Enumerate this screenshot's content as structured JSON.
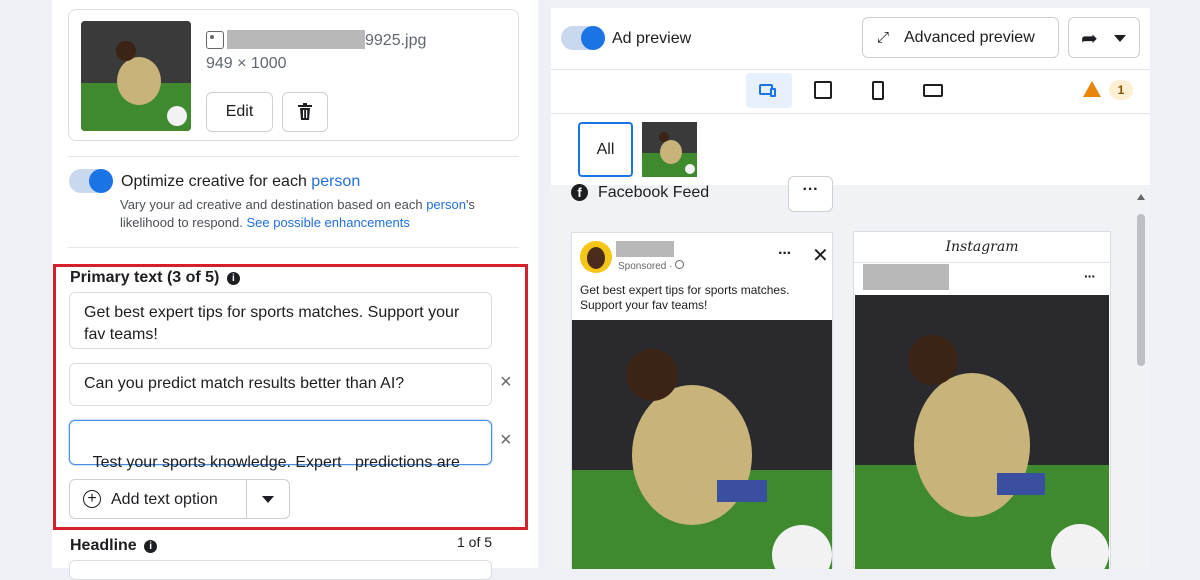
{
  "media": {
    "filename_suffix": "9925.jpg",
    "dimensions": "949 × 1000",
    "edit_label": "Edit"
  },
  "optimize": {
    "label_prefix": "Optimize creative for each ",
    "label_link": "person",
    "desc_prefix": "Vary your ad creative and destination based on each ",
    "desc_link1": "person",
    "desc_mid": "'s likelihood to respond. ",
    "desc_link2": "See possible enhancements"
  },
  "primary_text": {
    "title": "Primary text (3 of 5)",
    "options": [
      "Get best expert tips for sports matches. Support your fav teams!",
      "Can you predict match results better than AI?",
      "Test your sports knowledge. Expert   predictions are"
    ],
    "add_label": "Add text option"
  },
  "headline": {
    "title": "Headline",
    "counter": "1 of 5"
  },
  "preview": {
    "toggle_label": "Ad preview",
    "advanced_label": "Advanced preview",
    "warning_count": "1",
    "all_label": "All",
    "feed_label": "Facebook Feed",
    "colors": {
      "accent": "#1b74e4",
      "warning": "#e8860c",
      "highlight": "#d3202b"
    }
  },
  "fb_post": {
    "sponsored": "Sponsored · ",
    "text": "Get best expert tips for sports matches. Support your fav teams!"
  },
  "ig_post": {
    "brand": "Instagram"
  }
}
